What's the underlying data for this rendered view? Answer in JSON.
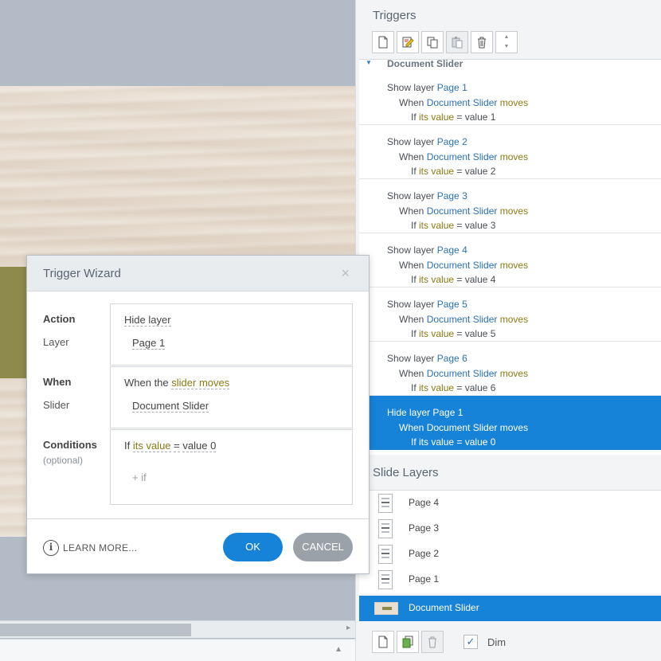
{
  "stage": {
    "scroll_arrow": "▸",
    "bottom_arrow": "▲"
  },
  "triggers_panel": {
    "title": "Triggers",
    "toolbar": [
      "new-trigger-icon",
      "edit-trigger-icon",
      "copy-trigger-icon",
      "paste-trigger-icon",
      "delete-trigger-icon",
      "move-up-down-icon"
    ],
    "group_name": "Document Slider",
    "triggers": [
      {
        "action": "Show layer ",
        "target": "Page 1",
        "when": "When ",
        "object": "Document Slider",
        "event": " moves",
        "cond_if": "If ",
        "cond_var": "its value",
        "cond_rest": " = value 1"
      },
      {
        "action": "Show layer ",
        "target": "Page 2",
        "when": "When ",
        "object": "Document Slider",
        "event": " moves",
        "cond_if": "If ",
        "cond_var": "its value",
        "cond_rest": " = value 2"
      },
      {
        "action": "Show layer ",
        "target": "Page 3",
        "when": "When ",
        "object": "Document Slider",
        "event": " moves",
        "cond_if": "If ",
        "cond_var": "its value",
        "cond_rest": " = value 3"
      },
      {
        "action": "Show layer ",
        "target": "Page 4",
        "when": "When ",
        "object": "Document Slider",
        "event": " moves",
        "cond_if": "If ",
        "cond_var": "its value",
        "cond_rest": " = value 4"
      },
      {
        "action": "Show layer ",
        "target": "Page 5",
        "when": "When ",
        "object": "Document Slider",
        "event": " moves",
        "cond_if": "If ",
        "cond_var": "its value",
        "cond_rest": " = value 5"
      },
      {
        "action": "Show layer ",
        "target": "Page 6",
        "when": "When ",
        "object": "Document Slider",
        "event": " moves",
        "cond_if": "If ",
        "cond_var": "its value",
        "cond_rest": " = value 6"
      },
      {
        "action": "Hide layer ",
        "target": "Page 1",
        "when": "When ",
        "object": "Document Slider",
        "event": " moves",
        "cond_if": "If ",
        "cond_var": "its value",
        "cond_rest": " = value 0",
        "selected": true
      }
    ]
  },
  "layers_panel": {
    "title": "Slide Layers",
    "layers": [
      "Page 4",
      "Page 3",
      "Page 2",
      "Page 1"
    ],
    "base_layer": "Document Slider",
    "dim_label": "Dim",
    "dim_checked": true,
    "check_glyph": "✓"
  },
  "dialog": {
    "title": "Trigger Wizard",
    "close_glyph": "×",
    "action_label": "Action",
    "layer_label": "Layer",
    "action_value": "Hide layer",
    "layer_value": "Page 1",
    "when_label": "When",
    "slider_label": "Slider",
    "when_prefix": "When the ",
    "when_value": "slider moves",
    "slider_value": "Document Slider",
    "conditions_label": "Conditions",
    "optional_label": "(optional)",
    "cond_if": "If ",
    "cond_var": "its value",
    "cond_op": "=",
    "cond_value": "value 0",
    "add_if": "+ if",
    "learn_icon": "i",
    "learn_more": "LEARN MORE...",
    "ok": "OK",
    "cancel": "CANCEL"
  },
  "colors": {
    "accent": "#1683d8",
    "link": "#2a72b5",
    "variable": "#8a7a14",
    "cancel": "#9aa1a8"
  }
}
